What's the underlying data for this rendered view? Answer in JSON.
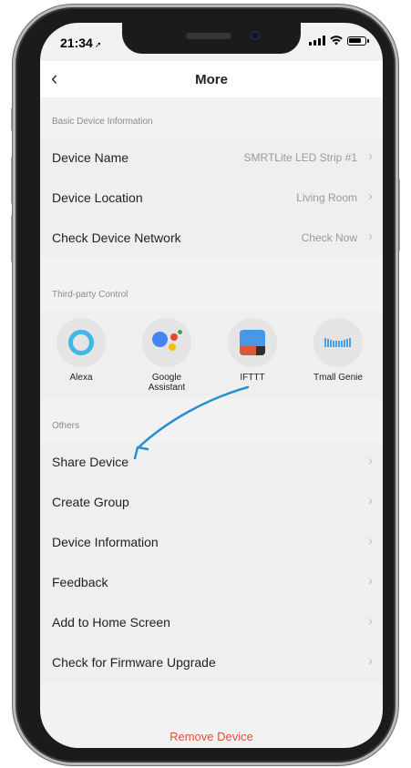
{
  "status_bar": {
    "time": "21:34",
    "location_glyph": "➚"
  },
  "nav": {
    "back_glyph": "‹",
    "title": "More"
  },
  "sections": {
    "basic": "Basic Device Information",
    "third_party": "Third-party Control",
    "others": "Others"
  },
  "basic_rows": [
    {
      "label": "Device Name",
      "value": "SMRTLite LED Strip #1"
    },
    {
      "label": "Device Location",
      "value": "Living Room"
    },
    {
      "label": "Check Device Network",
      "value": "Check Now"
    }
  ],
  "third_party": [
    {
      "label": "Alexa",
      "icon": "alexa-icon"
    },
    {
      "label": "Google Assistant",
      "icon": "google-assistant-icon"
    },
    {
      "label": "IFTTT",
      "icon": "ifttt-icon"
    },
    {
      "label": "Tmall Genie",
      "icon": "tmall-genie-icon"
    }
  ],
  "others_rows": [
    {
      "label": "Share Device"
    },
    {
      "label": "Create Group"
    },
    {
      "label": "Device Information"
    },
    {
      "label": "Feedback"
    },
    {
      "label": "Add to Home Screen"
    },
    {
      "label": "Check for Firmware Upgrade"
    }
  ],
  "chevron_glyph": "›",
  "remove_label": "Remove Device",
  "colors": {
    "accent_red": "#e0533a",
    "annotation_arrow": "#2a8fd0",
    "alexa_blue": "#3fb8e5"
  }
}
